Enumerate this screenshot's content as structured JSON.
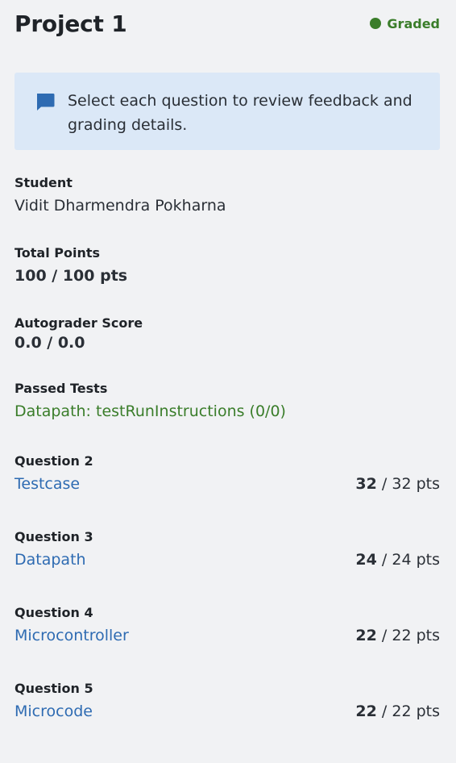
{
  "header": {
    "title": "Project 1",
    "status": "Graded",
    "status_color": "#3a7d2a"
  },
  "callout": {
    "icon": "comment-icon",
    "message": "Select each question to review feedback and grading details.",
    "background": "#dbe8f7",
    "icon_color": "#2e6bb2"
  },
  "student": {
    "label": "Student",
    "value": "Vidit Dharmendra Pokharna"
  },
  "total_points": {
    "label": "Total Points",
    "value": "100 / 100 pts"
  },
  "autograder": {
    "label": "Autograder Score",
    "value": "0.0 / 0.0"
  },
  "passed_tests": {
    "label": "Passed Tests",
    "items": [
      "Datapath: testRunInstructions (0/0)"
    ]
  },
  "questions": [
    {
      "label": "Question 2",
      "title": "Testcase",
      "score": "32",
      "max": "/ 32 pts"
    },
    {
      "label": "Question 3",
      "title": "Datapath",
      "score": "24",
      "max": "/ 24 pts"
    },
    {
      "label": "Question 4",
      "title": "Microcontroller",
      "score": "22",
      "max": "/ 22 pts"
    },
    {
      "label": "Question 5",
      "title": "Microcode",
      "score": "22",
      "max": "/ 22 pts"
    }
  ],
  "colors": {
    "link": "#2e6bb2",
    "passed": "#3a7d2a",
    "background": "#f1f2f4"
  }
}
